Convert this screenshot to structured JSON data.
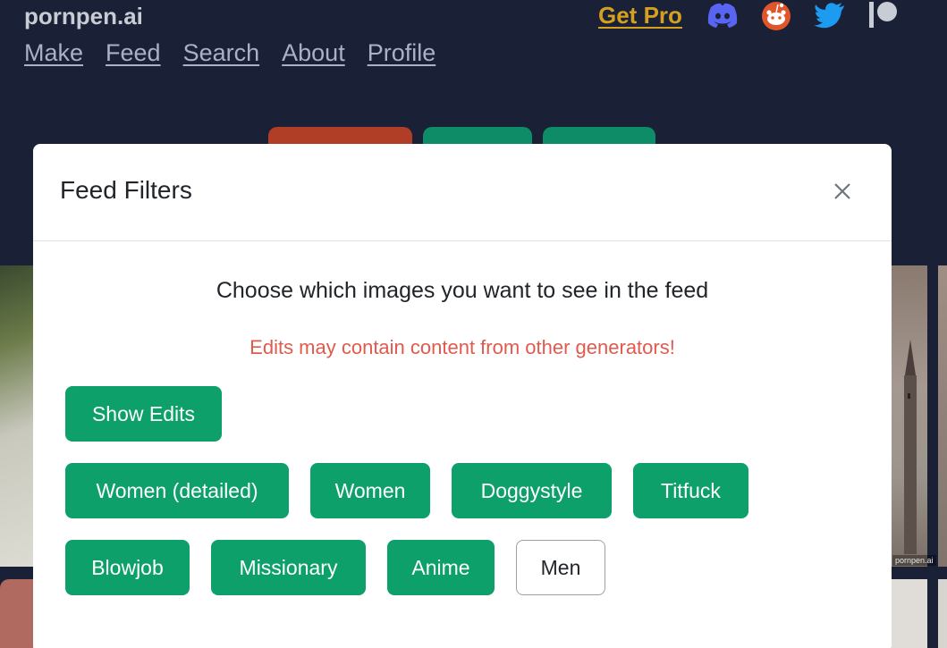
{
  "header": {
    "brand": "pornpen.ai",
    "nav": [
      "Make",
      "Feed",
      "Search",
      "About",
      "Profile"
    ],
    "get_pro": "Get Pro",
    "social_icons": [
      "discord-icon",
      "reddit-icon",
      "twitter-icon",
      "patreon-icon"
    ]
  },
  "background": {
    "watermark": "pornpen.ai"
  },
  "modal": {
    "title": "Feed Filters",
    "lead": "Choose which images you want to see in the feed",
    "warning": "Edits may contain content from other generators!",
    "show_edits": "Show Edits",
    "filters": [
      {
        "label": "Women (detailed)",
        "active": true
      },
      {
        "label": "Women",
        "active": true
      },
      {
        "label": "Doggystyle",
        "active": true
      },
      {
        "label": "Titfuck",
        "active": true
      },
      {
        "label": "Blowjob",
        "active": true
      },
      {
        "label": "Missionary",
        "active": true
      },
      {
        "label": "Anime",
        "active": true
      },
      {
        "label": "Men",
        "active": false
      }
    ]
  },
  "colors": {
    "page_bg": "#1a2035",
    "accent_green": "#0ea06b",
    "accent_red_tab": "#b03e26",
    "warning_text": "#e05a4e",
    "get_pro": "#d4a020"
  }
}
